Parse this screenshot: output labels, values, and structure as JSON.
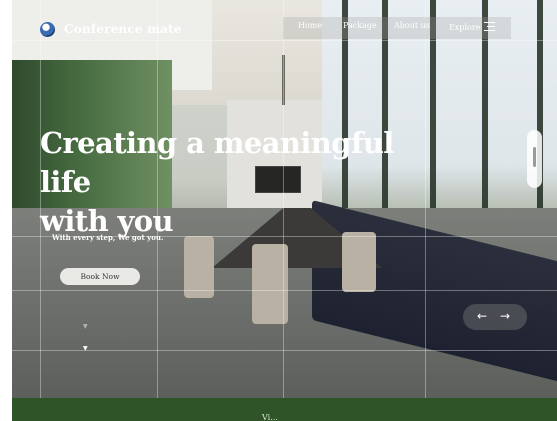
{
  "brand": {
    "name": "Conference mate",
    "icon": "globe-logo-icon"
  },
  "nav": {
    "items": [
      {
        "label": "Home"
      },
      {
        "label": "Package"
      },
      {
        "label": "About us"
      }
    ],
    "explore_label": "Explore",
    "menu_icon": "hamburger-menu-icon"
  },
  "hero": {
    "headline_line1": "Creating a meaningful life",
    "headline_line2": "with you",
    "subline": "With every step, We got you.",
    "cta_label": "Book Now"
  },
  "slider": {
    "prev_icon": "arrow-left-icon",
    "next_icon": "arrow-right-icon",
    "prev_glyph": "←",
    "next_glyph": "→"
  },
  "bottom": {
    "text": "Vi..."
  },
  "colors": {
    "accent": "#2f5428",
    "text_on_image": "#ffffff",
    "button_bg": "#e9e9e6"
  }
}
